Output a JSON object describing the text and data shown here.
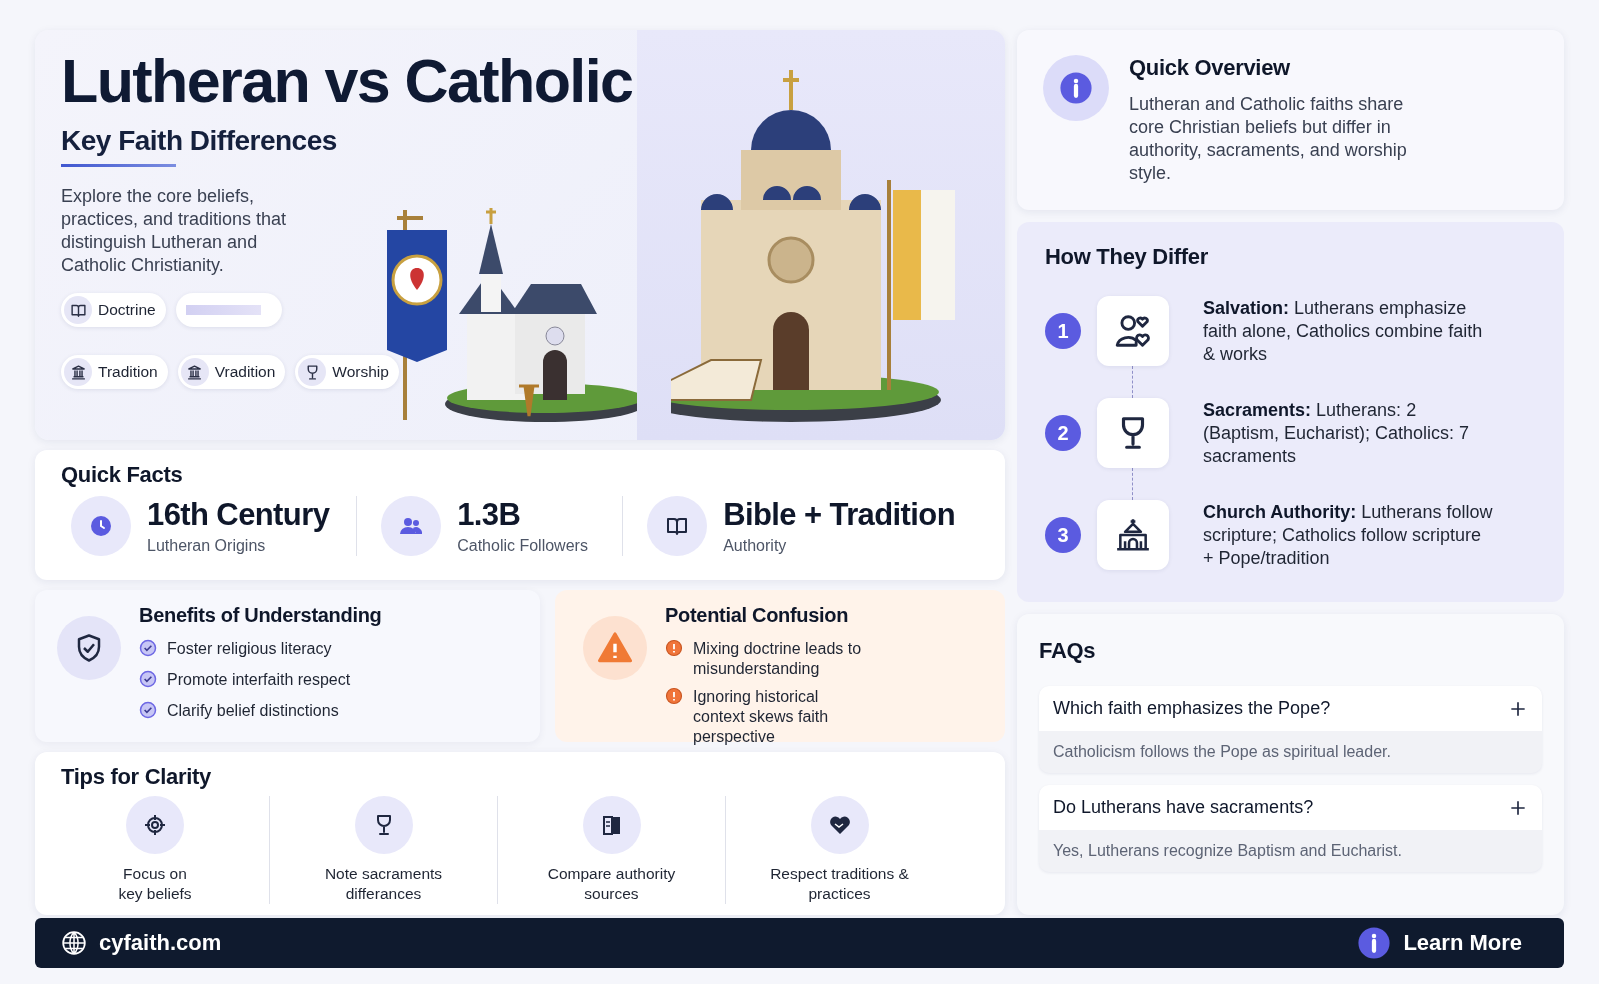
{
  "hero": {
    "title": "Lutheran vs Catholic",
    "subtitle": "Key Faith Differences",
    "intro": "Explore the core beliefs, practices, and traditions that distinguish Lutheran and Catholic Christianity.",
    "tags": [
      {
        "kind": "book",
        "label": "Doctrine"
      },
      {
        "kind": "pillar",
        "label": "Tradition"
      },
      {
        "kind": "pillar",
        "label": "Vradition"
      },
      {
        "kind": "chalice",
        "label": "Worship"
      }
    ]
  },
  "quick_facts": {
    "title": "Quick Facts",
    "items": [
      {
        "kind": "clock",
        "value": "16th Century",
        "label": "Lutheran Origins"
      },
      {
        "kind": "people",
        "value": "1.3B",
        "label": "Catholic Followers"
      },
      {
        "kind": "book",
        "value": "Bible + Tradition",
        "label": "Authority"
      }
    ]
  },
  "benefits": {
    "title": "Benefits of Understanding",
    "items": [
      "Foster religious literacy",
      "Promote interfaith respect",
      "Clarify belief distinctions"
    ]
  },
  "confusion": {
    "title": "Potential Confusion",
    "items": [
      "Mixing doctrine leads to misunderstanding",
      "Ignoring historical context skews faith perspective"
    ]
  },
  "tips": {
    "title": "Tips for Clarity",
    "items": [
      {
        "kind": "target",
        "label": "Focus on\nkey beliefs"
      },
      {
        "kind": "chalice",
        "label": "Note sacraments\ndifferances"
      },
      {
        "kind": "document",
        "label": "Compare authority\nsources"
      },
      {
        "kind": "heart",
        "label": "Respect traditions &\npractices"
      }
    ]
  },
  "overview": {
    "title": "Quick Overview",
    "text": "Lutheran and Catholic faiths share core Christian beliefs but differ in authority, sacraments, and worship style."
  },
  "differences": {
    "title": "How They Differ",
    "items": [
      {
        "number": "1",
        "kind": "person-heart",
        "text": "**Salvation:** Lutherans emphasize faith alone, Catholics combine faith & works"
      },
      {
        "number": "2",
        "kind": "chalice",
        "text": "**Sacraments:** Lutherans: 2 (Baptism, Eucharist); Catholics: 7 sacraments"
      },
      {
        "number": "3",
        "kind": "church",
        "text": "**Church Authority:** Lutherans follow scripture; Catholics follow scripture + Pope/tradition"
      }
    ]
  },
  "faqs": {
    "title": "FAQs",
    "items": [
      {
        "question": "Which faith emphasizes the Pope?",
        "answer": "Catholicism follows the Pope as spiritual leader."
      },
      {
        "question": "Do Lutherans have sacraments?",
        "answer": "Yes, Lutherans recognize Baptism and Eucharist."
      }
    ]
  },
  "footer": {
    "site": "cyfaith.com",
    "button": "Learn More"
  }
}
